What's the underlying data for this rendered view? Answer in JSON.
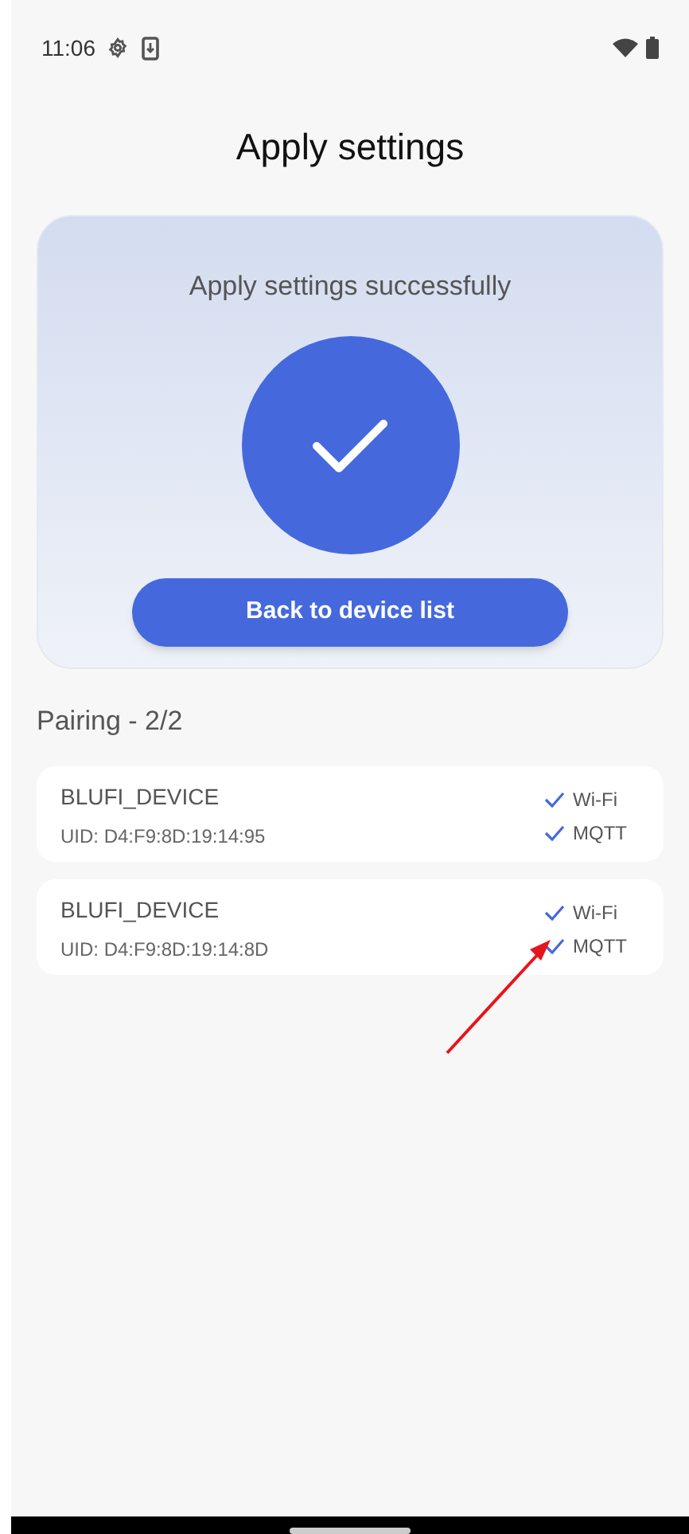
{
  "status_bar": {
    "time": "11:06"
  },
  "title": "Apply settings",
  "result": {
    "message": "Apply settings successfully",
    "success": true,
    "button": "Back to device list"
  },
  "pairing": {
    "heading": "Pairing - 2/2"
  },
  "devices": [
    {
      "name": "BLUFI_DEVICE",
      "uid": "UID: D4:F9:8D:19:14:95",
      "steps": [
        {
          "label": "Wi-Fi",
          "checked": true
        },
        {
          "label": "MQTT",
          "checked": true
        }
      ]
    },
    {
      "name": "BLUFI_DEVICE",
      "uid": "UID: D4:F9:8D:19:14:8D",
      "steps": [
        {
          "label": "Wi-Fi",
          "checked": true
        },
        {
          "label": "MQTT",
          "checked": true
        }
      ]
    }
  ]
}
